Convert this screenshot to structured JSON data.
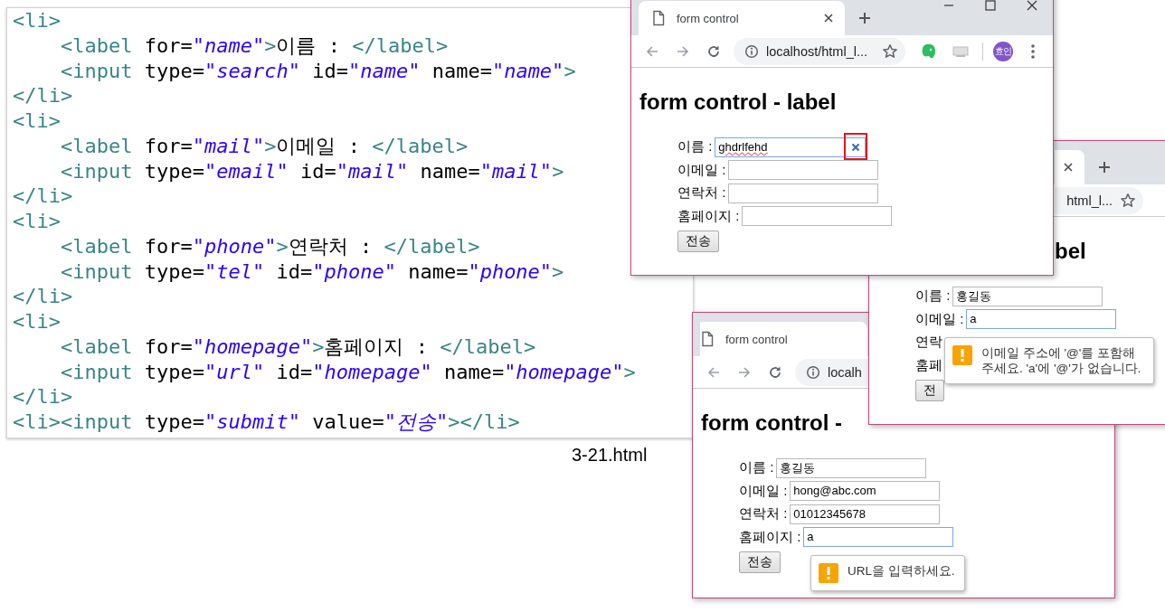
{
  "code_panel": {
    "lines": [
      "<li>",
      "    <label for=\"name\">이름 : </label>",
      "    <input type=\"search\" id=\"name\" name=\"name\">",
      "</li>",
      "<li>",
      "    <label for=\"mail\">이메일 : </label>",
      "    <input type=\"email\" id=\"mail\" name=\"mail\">",
      "</li>",
      "<li>",
      "    <label for=\"phone\">연락처 : </label>",
      "    <input type=\"tel\" id=\"phone\" name=\"phone\">",
      "</li>",
      "<li>",
      "    <label for=\"homepage\">홈페이지 : </label>",
      "    <input type=\"url\" id=\"homepage\" name=\"homepage\">",
      "</li>",
      "<li><input type=\"submit\" value=\"전송\"></li>"
    ]
  },
  "caption": "3-21.html",
  "windows": [
    {
      "tab_title": "form control",
      "tab_close_button": true,
      "new_tab_button": true,
      "window_controls": true,
      "nav_buttons": true,
      "site_info_icon": true,
      "address": "localhost/html_l...",
      "bookmark_star": true,
      "extensions": true,
      "avatar": "효인",
      "menu_button": true,
      "heading": "form control - label",
      "fields": [
        {
          "label": "이름 :",
          "value": "ghdrlfehd",
          "kind": "search",
          "focused": true,
          "misspelled": true,
          "clear_highlighted": true
        },
        {
          "label": "이메일 :",
          "kind": "text",
          "focused": false
        },
        {
          "label": "연락처 :",
          "kind": "text",
          "focused": false
        },
        {
          "label": "홈페이지 :",
          "kind": "text",
          "focused": false
        }
      ],
      "submit": "전송"
    },
    {
      "tab_close_button": true,
      "new_tab_button": true,
      "address": "html_l...",
      "bookmark_star": true,
      "heading": "bel",
      "fields": [
        {
          "label": "이름 :",
          "value": "홍길동",
          "kind": "text",
          "focused": false
        },
        {
          "label": "이메일 :",
          "value": "a",
          "kind": "text",
          "focused": true
        },
        {
          "label": "연락",
          "kind": "label_only"
        },
        {
          "label": "홈페",
          "kind": "label_only"
        }
      ],
      "submit": "전",
      "tooltip": "이메일 주소에 '@'를 포함해 주세요. 'a'에 '@'가 없습니다."
    },
    {
      "tab_title": "form control",
      "nav_buttons": true,
      "site_info_icon": true,
      "address": "localh",
      "heading": "form control -",
      "fields": [
        {
          "label": "이름 :",
          "value": "홍길동",
          "kind": "text",
          "focused": false
        },
        {
          "label": "이메일 :",
          "value": "hong@abc.com",
          "kind": "text",
          "focused": false
        },
        {
          "label": "연락처 :",
          "value": "01012345678",
          "kind": "text",
          "focused": false
        },
        {
          "label": "홈페이지 :",
          "value": "a",
          "kind": "text",
          "focused": true
        }
      ],
      "submit": "전송",
      "tooltip": "URL을 입력하세요."
    }
  ]
}
